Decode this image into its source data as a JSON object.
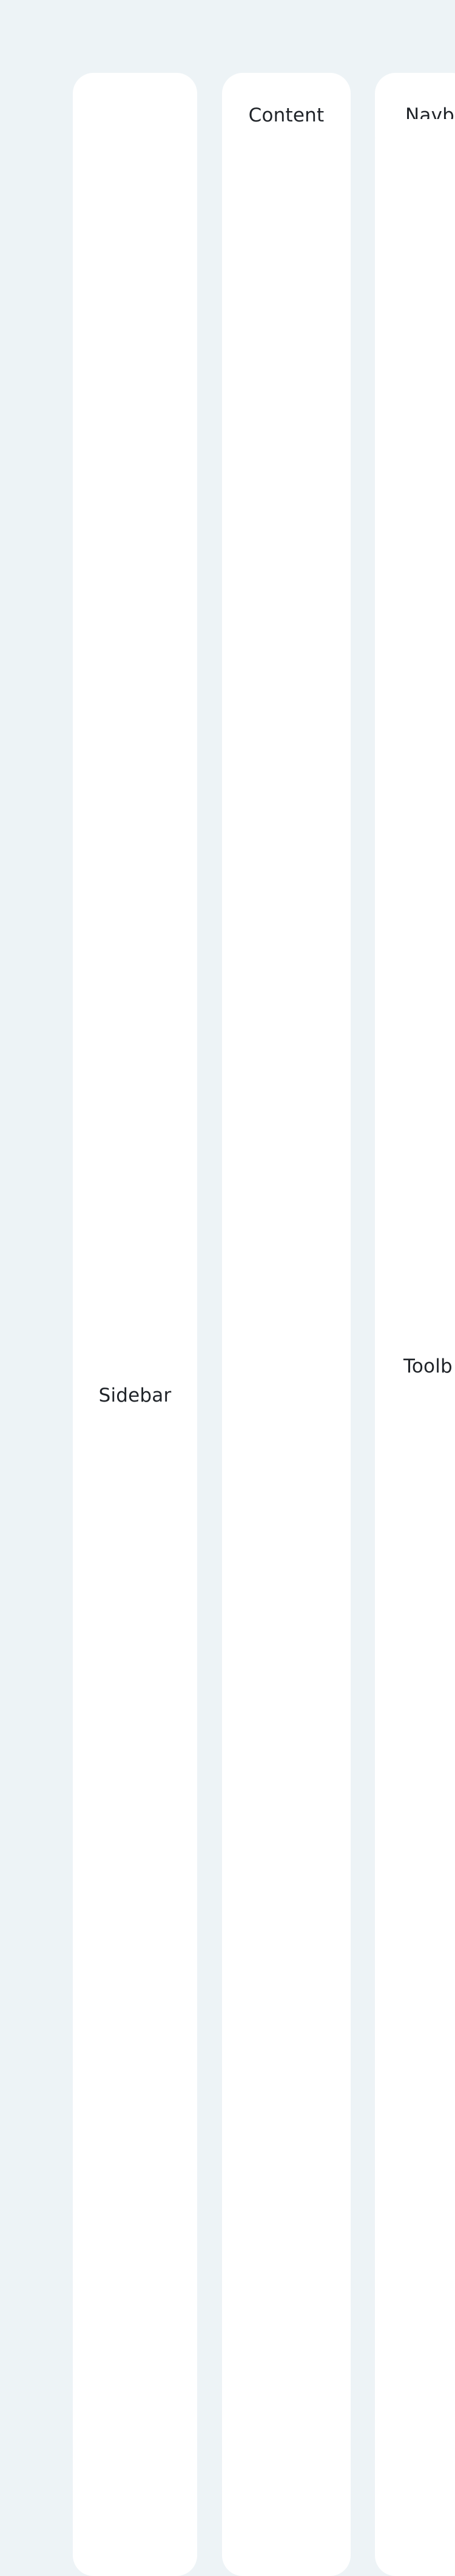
{
  "panels": {
    "sidebar": {
      "label": "Sidebar"
    },
    "content": {
      "label": "Content"
    },
    "navbar": {
      "label": "Navba"
    },
    "toolbar": {
      "label": "Toolb"
    }
  },
  "colors": {
    "background": "#edf3f6",
    "panel": "#ffffff",
    "text": "#1f2328"
  }
}
